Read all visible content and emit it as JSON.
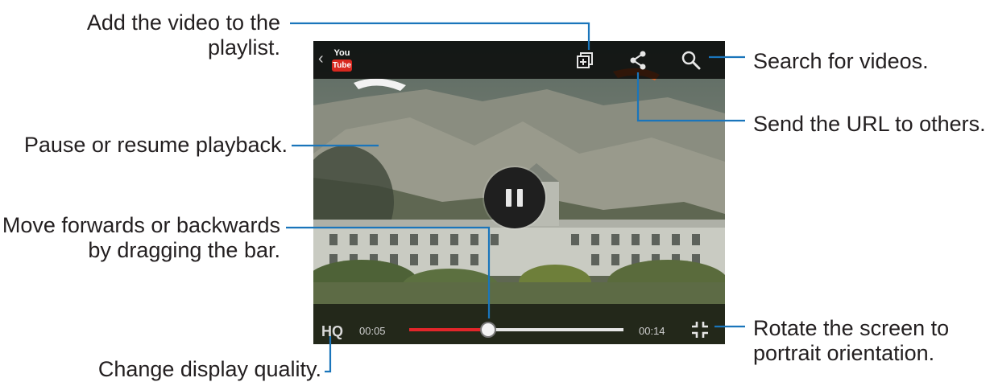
{
  "player": {
    "app_logo": {
      "line1": "You",
      "line2": "Tube"
    },
    "quality_label": "HQ",
    "current_time": "00:05",
    "total_time": "00:14",
    "progress": 0.37
  },
  "annotations": {
    "add_to_playlist": "Add the video to the playlist.",
    "search": "Search for videos.",
    "send_url": "Send the URL to others.",
    "pause_resume": "Pause or resume playback.",
    "seek_bar": "Move forwards or backwards by dragging the bar.",
    "rotate": "Rotate the screen to portrait orientation.",
    "quality": "Change display quality."
  },
  "colors": {
    "callout_line": "#1a75bb",
    "progress_fill": "#e2262a",
    "text": "#231f20"
  }
}
